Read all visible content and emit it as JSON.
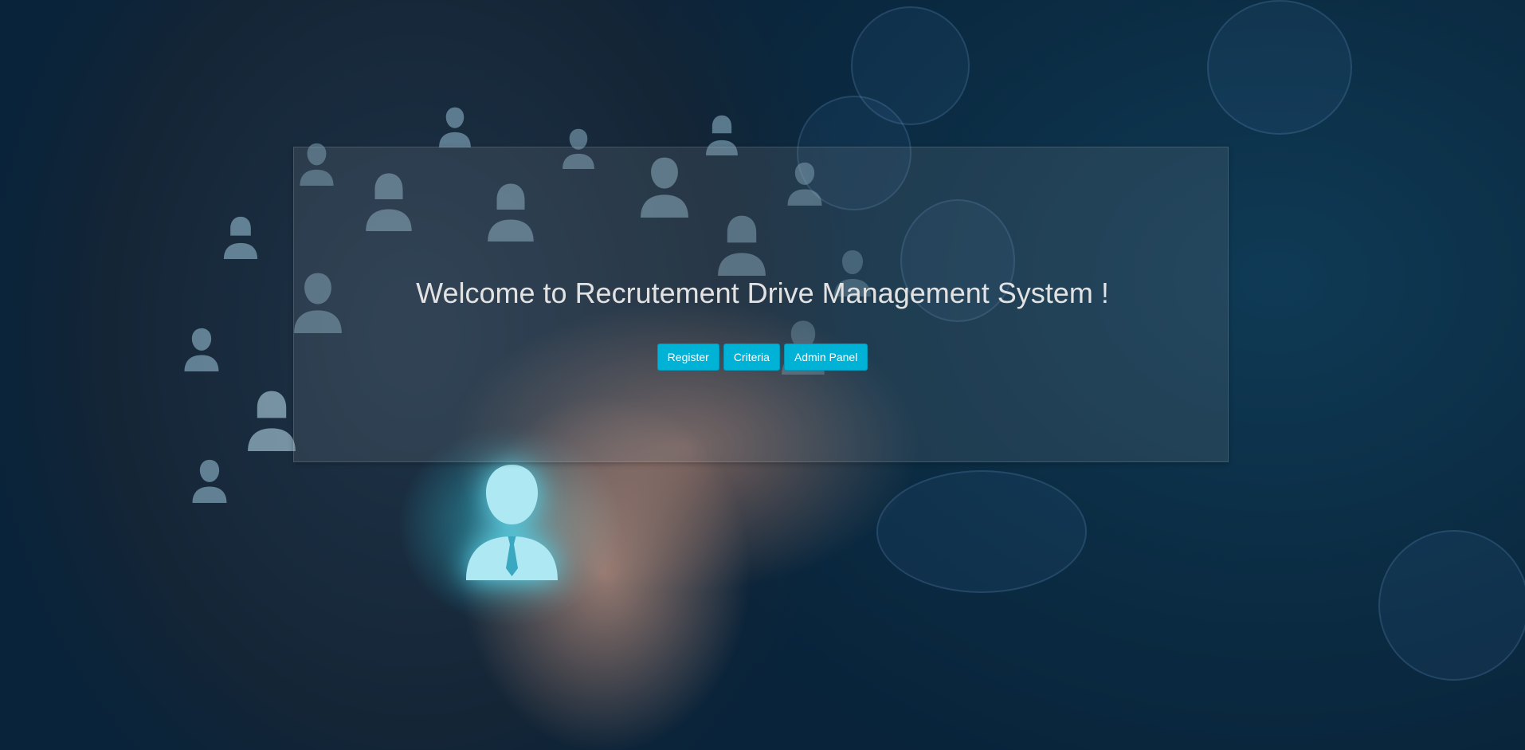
{
  "hero": {
    "title": "Welcome to Recrutement Drive Management System !",
    "accent_color": "#00b2d6"
  },
  "actions": {
    "register_label": "Register",
    "criteria_label": "Criteria",
    "admin_panel_label": "Admin Panel"
  },
  "background": {
    "icon_name": "person-icon"
  }
}
